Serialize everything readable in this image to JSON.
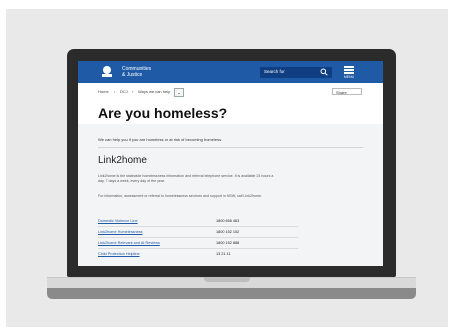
{
  "site": {
    "brand_line1": "Communities",
    "brand_line2": "& Justice",
    "search_placeholder": "Search for",
    "menu_label": "MENU"
  },
  "breadcrumb": {
    "items": [
      "Home",
      "DCJ",
      "Ways we can help"
    ],
    "share_label": "Share"
  },
  "page": {
    "title": "Are you homeless?",
    "intro": "We can help you if you are homeless or at risk of becoming homeless.",
    "section_title": "Link2home",
    "paragraph1": "Link2home is the statewide homelessness information and referral telephone service. It is available 24 hours a day, 7 days a week, every day of the year.",
    "paragraph2": "For information, assessment or referral to homelessness services and support in NSW, call Link2home."
  },
  "contacts": [
    {
      "label": "Domestic Violence Line",
      "number": "1800 656 463"
    },
    {
      "label": "Link2home Homelessness",
      "number": "1800 152 152"
    },
    {
      "label": "Link2home Relevant and At Reviews",
      "number": "1800 152 888"
    },
    {
      "label": "Child Protection Helpline",
      "number": "13 21 11"
    }
  ],
  "colors": {
    "accent": "#1f5aa6",
    "panel": "#f3f4f6",
    "laptop_frame": "#2b2b2b"
  },
  "icons": {
    "logo": "nsw-waratah-logo-icon",
    "search": "search-icon",
    "menu": "hamburger-menu-icon"
  }
}
